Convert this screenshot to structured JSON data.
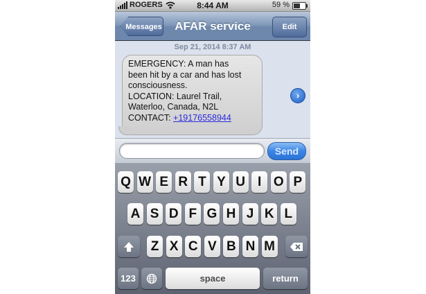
{
  "status_bar": {
    "carrier": "ROGERS",
    "time": "8:44 AM",
    "battery_percent": "59 %",
    "battery_level": 0.59,
    "icons": [
      "signal-bars-icon",
      "wifi-icon",
      "battery-icon"
    ]
  },
  "nav": {
    "back_label": "Messages",
    "title": "AFAR service",
    "edit_label": "Edit"
  },
  "conversation": {
    "date": "Sep 21, 2014 8:37 AM",
    "message_lines": [
      "EMERGENCY: A man has",
      "been hit by a car and has lost",
      "consciousness.",
      "LOCATION: Laurel Trail,",
      "Waterloo, Canada, N2L",
      "CONTACT: "
    ],
    "phone_link": "+19176558944",
    "detail_icon": "chevron-right-icon"
  },
  "compose": {
    "input_value": "",
    "send_label": "Send"
  },
  "keyboard": {
    "row1": [
      "Q",
      "W",
      "E",
      "R",
      "T",
      "Y",
      "U",
      "I",
      "O",
      "P"
    ],
    "row2": [
      "A",
      "S",
      "D",
      "F",
      "G",
      "H",
      "J",
      "K",
      "L"
    ],
    "row3": [
      "Z",
      "X",
      "C",
      "V",
      "B",
      "N",
      "M"
    ],
    "shift_icon": "shift-arrow-icon",
    "delete_icon": "backspace-icon",
    "numbers_label": "123",
    "globe_icon": "globe-icon",
    "space_label": "space",
    "return_label": "return"
  },
  "colors": {
    "nav_blue": "#6d87ac",
    "send_blue": "#3a86e6",
    "link_blue": "#2a2ae0"
  }
}
